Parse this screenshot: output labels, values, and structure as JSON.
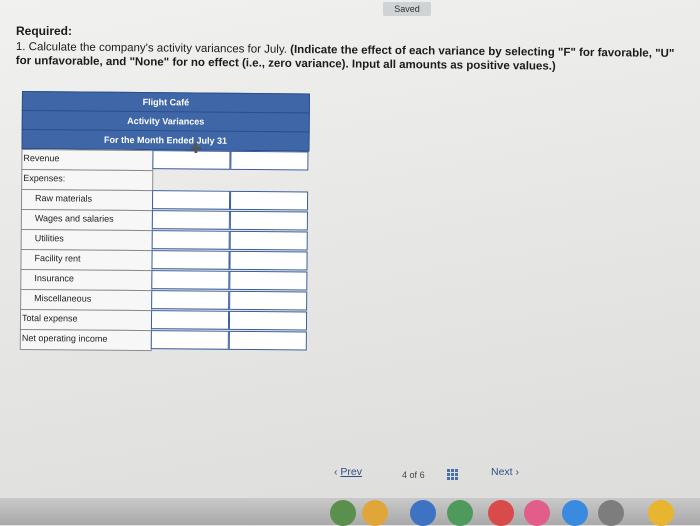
{
  "status": {
    "saved": "Saved"
  },
  "question": {
    "heading": "Required:",
    "text_plain": "1. Calculate the company's activity variances for July. ",
    "text_bold": "(Indicate the effect of each variance by selecting \"F\" for favorable, \"U\" for unfavorable, and \"None\" for no effect (i.e., zero variance). Input all amounts as positive values.)"
  },
  "worksheet": {
    "company": "Flight Café",
    "title": "Activity Variances",
    "period": "For the Month Ended July 31",
    "rows": [
      "Revenue",
      "Expenses:",
      "Raw materials",
      "Wages and salaries",
      "Utilities",
      "Facility rent",
      "Insurance",
      "Miscellaneous",
      "Total expense",
      "Net operating income"
    ]
  },
  "pager": {
    "prev": "Prev",
    "current": "4",
    "of_label": "of",
    "total": "6",
    "next": "Next"
  },
  "icons": [
    "chevron-left-icon",
    "grid-icon",
    "chevron-right-icon",
    "crosshair-cursor-icon"
  ]
}
